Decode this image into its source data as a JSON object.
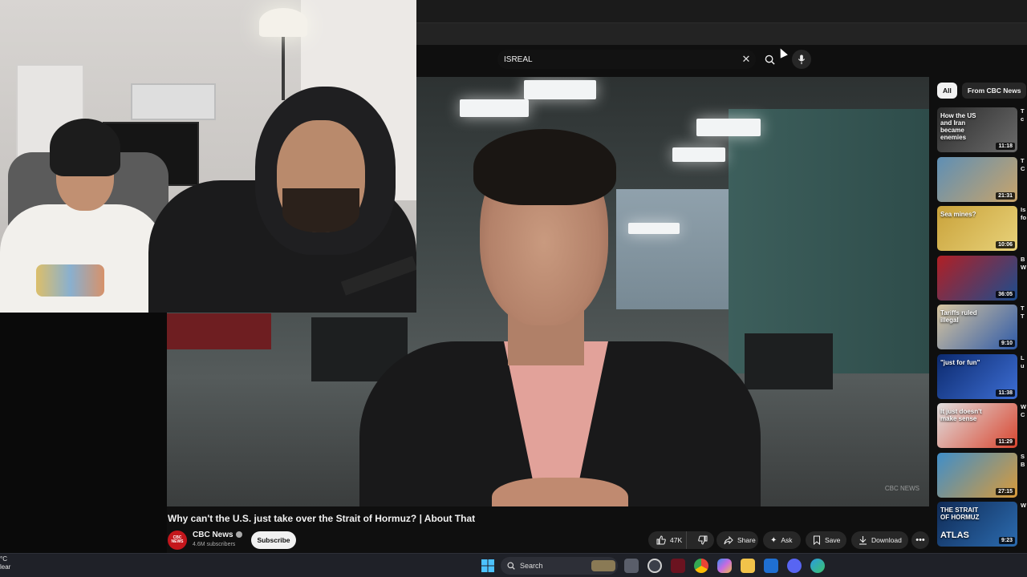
{
  "search": {
    "query": "ISREAL"
  },
  "video": {
    "title": "Why can't the U.S. just take over the Strait of Hormuz? | About That",
    "watermark": "CBC NEWS"
  },
  "channel": {
    "name": "CBC News",
    "subscribers": "4.6M subscribers",
    "avatar_text": "CBC NEWS",
    "subscribe_label": "Subscribe"
  },
  "actions": {
    "likes": "47K",
    "share": "Share",
    "ask": "Ask",
    "save": "Save",
    "download": "Download"
  },
  "chips": [
    {
      "label": "All",
      "active": true
    },
    {
      "label": "From CBC News",
      "active": false
    }
  ],
  "recommendations": [
    {
      "overlay": "How the US and Iran became enemies",
      "duration": "11:18",
      "side": "T c",
      "color_a": "#2b2b2b",
      "color_b": "#6b6b6b"
    },
    {
      "overlay": "",
      "duration": "21:31",
      "side": "T C",
      "color_a": "#5e8fb5",
      "color_b": "#c9a46a"
    },
    {
      "overlay": "Sea mines?",
      "duration": "10:06",
      "side": "Is fo",
      "color_a": "#c9a23a",
      "color_b": "#e8d27a"
    },
    {
      "overlay": "",
      "duration": "36:05",
      "side": "B W",
      "color_a": "#b11f24",
      "color_b": "#1b4d8f"
    },
    {
      "overlay": "Tariffs ruled illegal",
      "duration": "9:10",
      "side": "T T",
      "color_a": "#d8c6a0",
      "color_b": "#2e5aa8"
    },
    {
      "overlay": "\"just for fun\"",
      "duration": "11:38",
      "side": "L u",
      "color_a": "#0c2a6e",
      "color_b": "#3d6ed4"
    },
    {
      "overlay": "It just doesn't make sense",
      "duration": "11:29",
      "side": "W C",
      "color_a": "#e0e0e0",
      "color_b": "#d9452f"
    },
    {
      "overlay": "",
      "duration": "27:15",
      "side": "S B",
      "color_a": "#3f8ec9",
      "color_b": "#d99b3a"
    },
    {
      "overlay": "THE STRAIT OF HORMUZ",
      "duration": "9:23",
      "side": "W",
      "color_a": "#0f2a55",
      "color_b": "#2c6cb0"
    }
  ],
  "rec_atlas_label": "ATLAS",
  "taskbar": {
    "weather_temp": "°C",
    "weather_desc": "lear",
    "search_label": "Search"
  }
}
